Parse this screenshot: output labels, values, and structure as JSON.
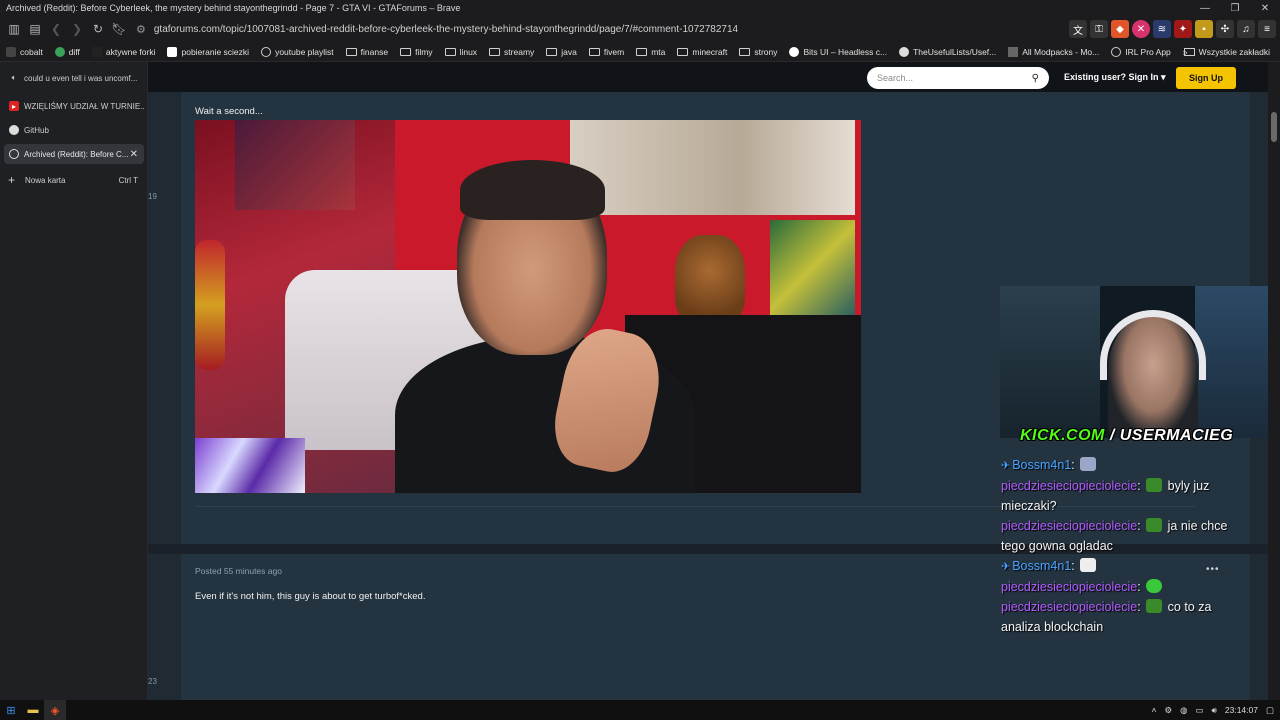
{
  "window": {
    "title": "Archived (Reddit): Before Cyberleek, the mystery behind stayonthegrindd - Page 7 - GTA VI - GTAForums – Brave",
    "controls": [
      "—",
      "❐",
      "✕"
    ]
  },
  "nav": {
    "url": "gtaforums.com/topic/1007081-archived-reddit-before-cyberleek-the-mystery-behind-stayonthegrindd/page/7/#comment-1072782714"
  },
  "bookmarks": {
    "items": [
      "cobalt",
      "diff",
      "aktywne forki",
      "pobieranie sciezki",
      "youtube playlist",
      "finanse",
      "filmy",
      "linux",
      "streamy",
      "java",
      "fivem",
      "mta",
      "minecraft",
      "strony",
      "Bits UI – Headless c...",
      "TheUsefulLists/Usef...",
      "All Modpacks - Mo...",
      "IRL Pro App"
    ],
    "overflow": "»",
    "all_bookmarks": "Wszystkie zakładki"
  },
  "sidebar": {
    "tabs": [
      {
        "label": "could u even tell i was uncomf..."
      },
      {
        "label": "WZIĘLIŚMY UDZIAŁ W TURNIE..."
      },
      {
        "label": "GitHub"
      },
      {
        "label": "Archived (Reddit): Before C..."
      }
    ],
    "new_tab": {
      "label": "Nowa karta",
      "shortcut": "Ctrl   T"
    }
  },
  "forum": {
    "search_placeholder": "Search...",
    "signin_label": "Existing user? Sign In ▾",
    "signup_label": "Sign Up",
    "post1": {
      "number": "19",
      "text": "Wait a second..."
    },
    "post2": {
      "number": "23",
      "meta": "Posted 55 minutes ago",
      "text": "Even if it's not him, this guy is about to get turbof*cked.",
      "more": "•••"
    }
  },
  "overlay": {
    "cam_label_kick": "KICK.COM",
    "cam_label_user": " / USERMACIEG",
    "chat": [
      {
        "user": "Bossm4n1",
        "color": "blue",
        "text": ""
      },
      {
        "user": "piecdziesieciopieciolecie",
        "color": "purple",
        "text": "byly juz mieczaki?"
      },
      {
        "user": "piecdziesieciopieciolecie",
        "color": "purple",
        "text": "ja nie chce tego gowna ogladac"
      },
      {
        "user": "Bossm4n1",
        "color": "blue",
        "text": ""
      },
      {
        "user": "piecdziesieciopieciolecie",
        "color": "purple",
        "text": ""
      },
      {
        "user": "piecdziesieciopieciolecie",
        "color": "purple",
        "text": "co to za analiza blockchain"
      }
    ]
  },
  "taskbar": {
    "time": "23:14:07"
  },
  "colors": {
    "accent_yellow": "#f5c400",
    "kick_green": "#53fc18",
    "chat_blue": "#4aa3ff",
    "chat_purple": "#b25cff"
  }
}
